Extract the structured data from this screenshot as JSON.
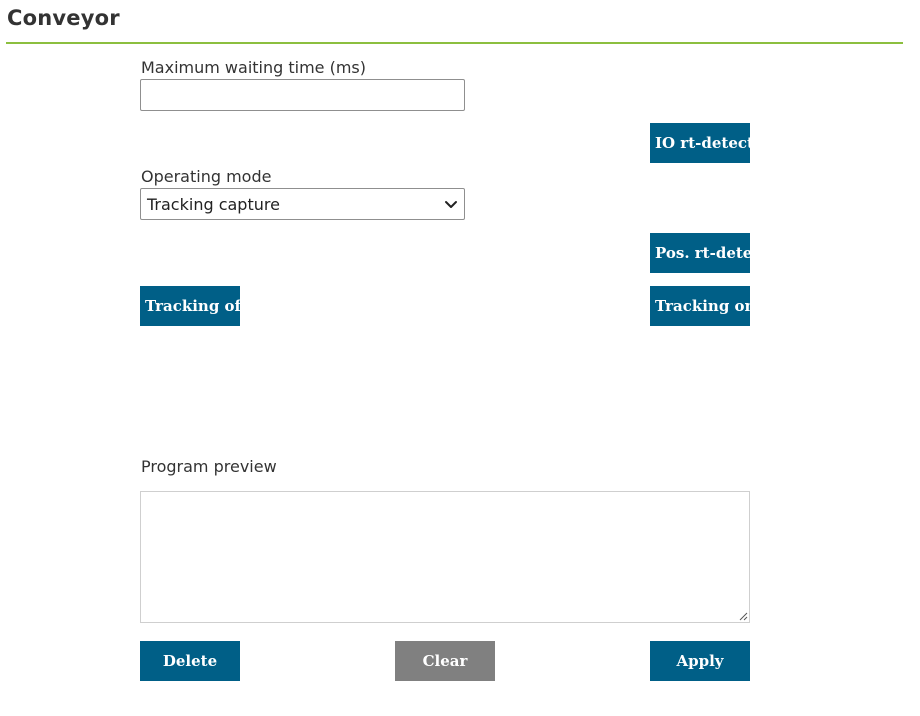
{
  "page": {
    "title": "Conveyor",
    "accent_color": "#8cbf3f",
    "button_color": "#005f87",
    "disabled_button_color": "#808080"
  },
  "form": {
    "max_wait": {
      "label": "Maximum waiting time (ms)",
      "value": "",
      "placeholder": ""
    },
    "operating_mode": {
      "label": "Operating mode",
      "selected": "Tracking capture",
      "icon": "chevron-down-icon"
    },
    "program_preview": {
      "label": "Program preview",
      "value": ""
    }
  },
  "buttons": {
    "io_rt_detect": "IO rt-detect",
    "pos_rt_detect": "Pos. rt-detect",
    "tracking_off": "Tracking off",
    "tracking_on": "Tracking on",
    "delete": "Delete",
    "clear": "Clear",
    "apply": "Apply"
  }
}
